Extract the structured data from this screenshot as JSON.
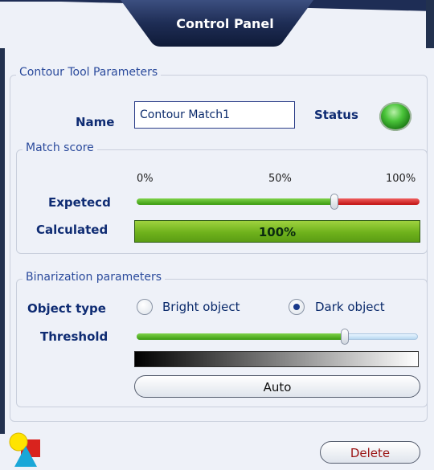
{
  "panel": {
    "title": "Control Panel",
    "header_color": "#1e2d55"
  },
  "contour_params": {
    "legend": "Contour Tool Parameters",
    "name_label": "Name",
    "name_value": "Contour Match1",
    "status_label": "Status",
    "status_color": "#4ac43a"
  },
  "match_score": {
    "legend": "Match score",
    "ticks": [
      "0%",
      "50%",
      "100%"
    ],
    "expected_label": "Expetecd",
    "expected_fraction": 0.7,
    "calculated_label": "Calculated",
    "calculated_value": "100%",
    "calculated_fraction": 1.0,
    "track_ok_color": "#4aa81c",
    "track_bad_color": "#d81e1e"
  },
  "binarization": {
    "legend": "Binarization parameters",
    "object_type_label": "Object type",
    "options": [
      "Bright object",
      "Dark object"
    ],
    "selected_option": "Dark object",
    "threshold_label": "Threshold",
    "threshold_fraction": 0.74,
    "auto_label": "Auto"
  },
  "footer": {
    "delete_label": "Delete",
    "logo_icon": "shapes-logo-icon"
  }
}
